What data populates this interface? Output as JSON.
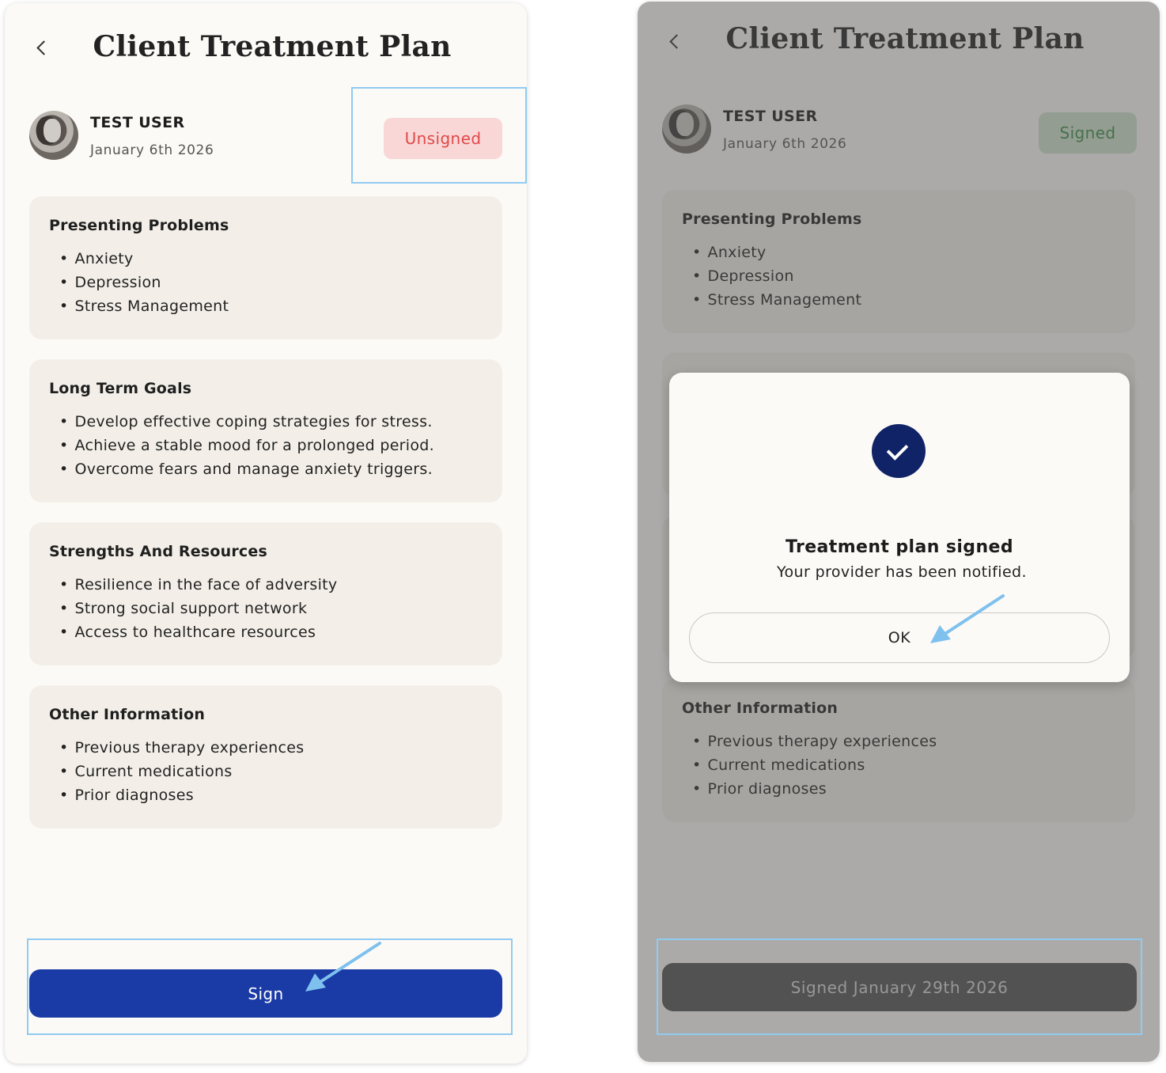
{
  "colors": {
    "sign_button": "#1a3aa6",
    "unsigned_badge_bg": "#f8d7d6",
    "unsigned_badge_text": "#e0494a",
    "signed_badge_bg": "#cfe1cb",
    "signed_badge_text": "#3a8a45",
    "highlight": "#8fcbf2",
    "check_circle": "#0f2366"
  },
  "before": {
    "title": "Client Treatment Plan",
    "user": {
      "name": "TEST USER",
      "date": "January 6th 2026"
    },
    "status_badge": "Unsigned",
    "sections": [
      {
        "heading": "Presenting Problems",
        "items": [
          "Anxiety",
          "Depression",
          "Stress Management"
        ]
      },
      {
        "heading": "Long Term Goals",
        "items": [
          "Develop effective coping strategies for stress.",
          "Achieve a stable mood for a prolonged period.",
          "Overcome fears and manage anxiety triggers."
        ]
      },
      {
        "heading": "Strengths And Resources",
        "items": [
          "Resilience in the face of adversity",
          "Strong social support network",
          "Access to healthcare resources"
        ]
      },
      {
        "heading": "Other Information",
        "items": [
          "Previous therapy experiences",
          "Current medications",
          "Prior diagnoses"
        ]
      }
    ],
    "sign_button": "Sign"
  },
  "after": {
    "title": "Client Treatment Plan",
    "user": {
      "name": "TEST USER",
      "date": "January 6th 2026"
    },
    "status_badge": "Signed",
    "sections": [
      {
        "heading": "Presenting Problems",
        "items": [
          "Anxiety",
          "Depression",
          "Stress Management"
        ]
      },
      {
        "heading": "Other Information",
        "items": [
          "Previous therapy experiences",
          "Current medications",
          "Prior diagnoses"
        ]
      }
    ],
    "modal": {
      "title": "Treatment plan signed",
      "subtitle": "Your provider has been notified.",
      "ok_button": "OK"
    },
    "signed_button": "Signed January 29th 2026"
  }
}
